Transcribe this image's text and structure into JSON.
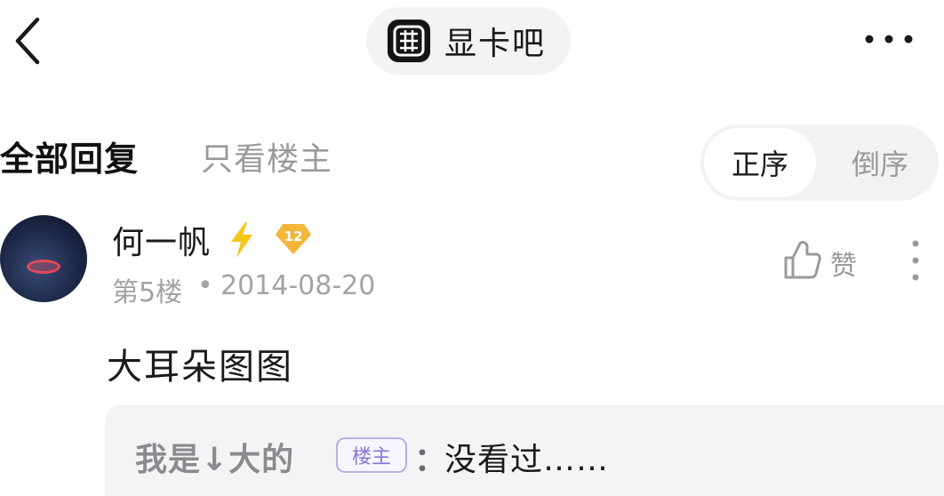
{
  "header": {
    "forum_name": "显卡吧",
    "back_icon": "chevron-left-icon",
    "more_icon": "more-horizontal-icon"
  },
  "tabs": {
    "all": "全部回复",
    "op_only": "只看楼主"
  },
  "sort": {
    "asc": "正序",
    "desc": "倒序",
    "selected": "正序"
  },
  "reply": {
    "username": "何一帆",
    "level": "12",
    "floor": "第5楼",
    "separator": "•",
    "date": "2014-08-20",
    "like_label": "赞",
    "content": "大耳朵图图",
    "subreply": {
      "author": "我是↓大的",
      "badge": "楼主",
      "colon": "：",
      "text": "没看过……"
    }
  },
  "colors": {
    "accent_badge": "#8a76d6",
    "bolt": "#f5c518",
    "level_badge": "#f4b63a"
  }
}
